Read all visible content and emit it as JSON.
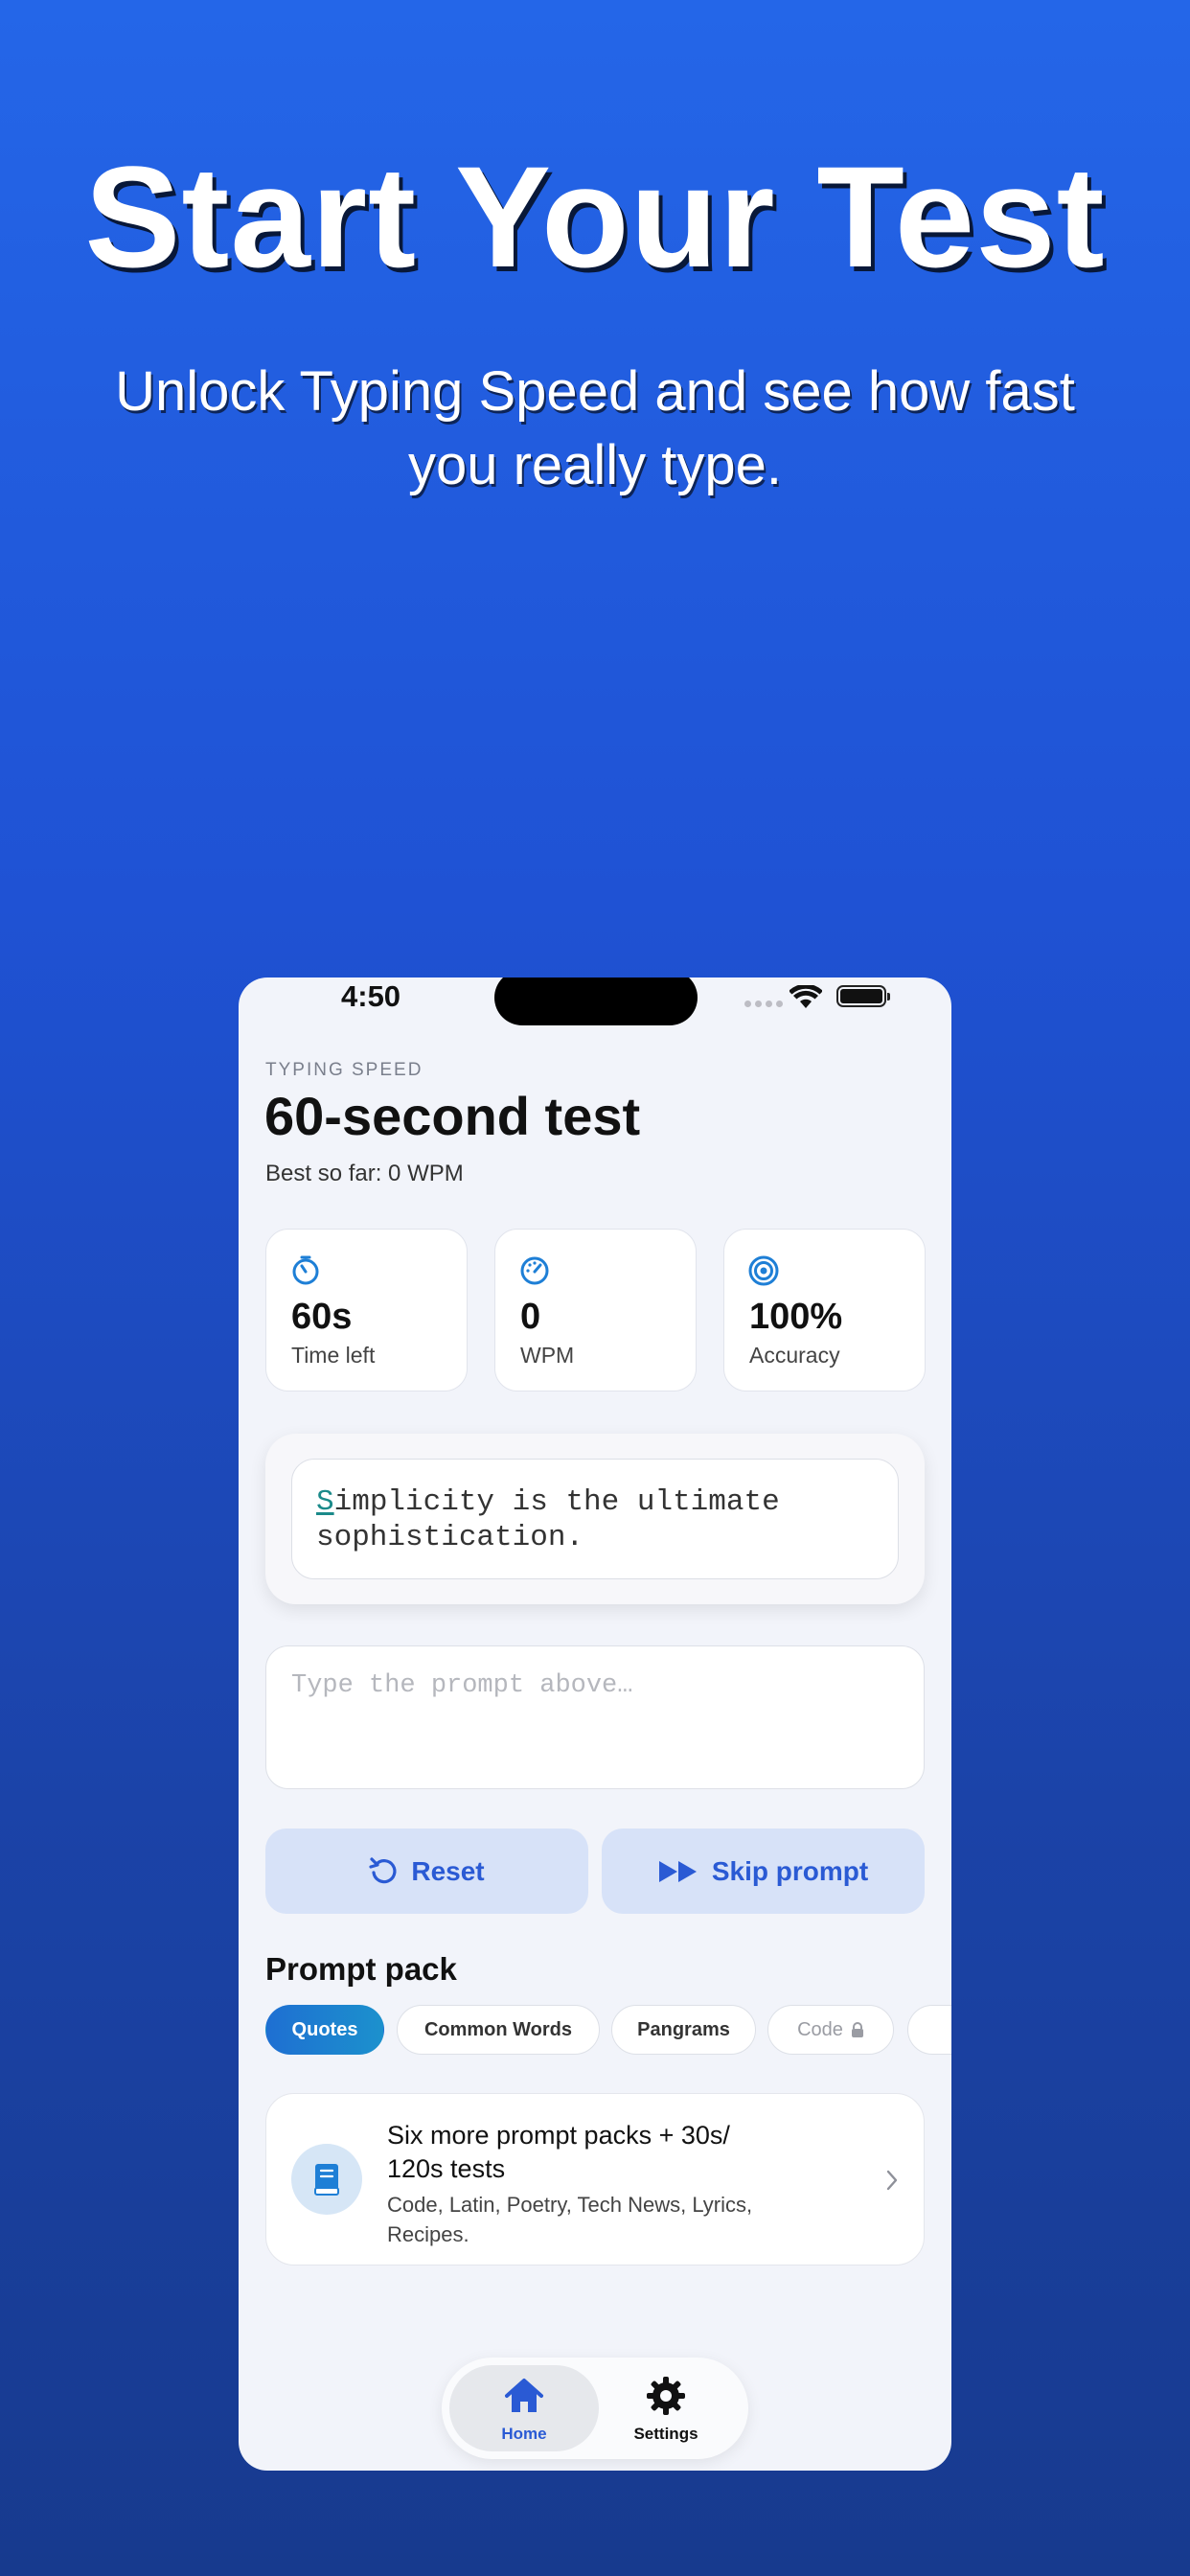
{
  "hero": {
    "title": "Start Your Test",
    "subtitle": "Unlock Typing Speed and see how fast you really type."
  },
  "status_bar": {
    "time": "4:50"
  },
  "header": {
    "eyebrow": "TYPING SPEED",
    "title": "60-second test",
    "best": "Best so far: 0 WPM"
  },
  "stats": [
    {
      "icon": "timer-icon",
      "value": "60s",
      "label": "Time left"
    },
    {
      "icon": "speedometer-icon",
      "value": "0",
      "label": "WPM"
    },
    {
      "icon": "target-icon",
      "value": "100%",
      "label": "Accuracy"
    }
  ],
  "prompt": {
    "first_char": "S",
    "rest": "implicity is the ultimate sophistication."
  },
  "input": {
    "placeholder": "Type the prompt above…",
    "value": ""
  },
  "buttons": {
    "reset": "Reset",
    "skip": "Skip prompt"
  },
  "prompt_pack": {
    "title": "Prompt pack",
    "chips": [
      {
        "label": "Quotes",
        "active": true
      },
      {
        "label": "Common Words"
      },
      {
        "label": "Pangrams"
      },
      {
        "label": "Code",
        "locked": true
      }
    ]
  },
  "upsell": {
    "headline": "Six more prompt packs + 30s/ 120s tests",
    "details": "Code, Latin, Poetry, Tech News, Lyrics, Recipes."
  },
  "tabs": [
    {
      "label": "Home",
      "icon": "house-icon",
      "active": true
    },
    {
      "label": "Settings",
      "icon": "gear-icon"
    }
  ],
  "colors": {
    "accent": "#2a5ad4",
    "chip_active": "#1e6fd2",
    "stat_icon": "#1e7fd6",
    "background_top": "#2466e8",
    "background_bottom": "#173a8e"
  }
}
